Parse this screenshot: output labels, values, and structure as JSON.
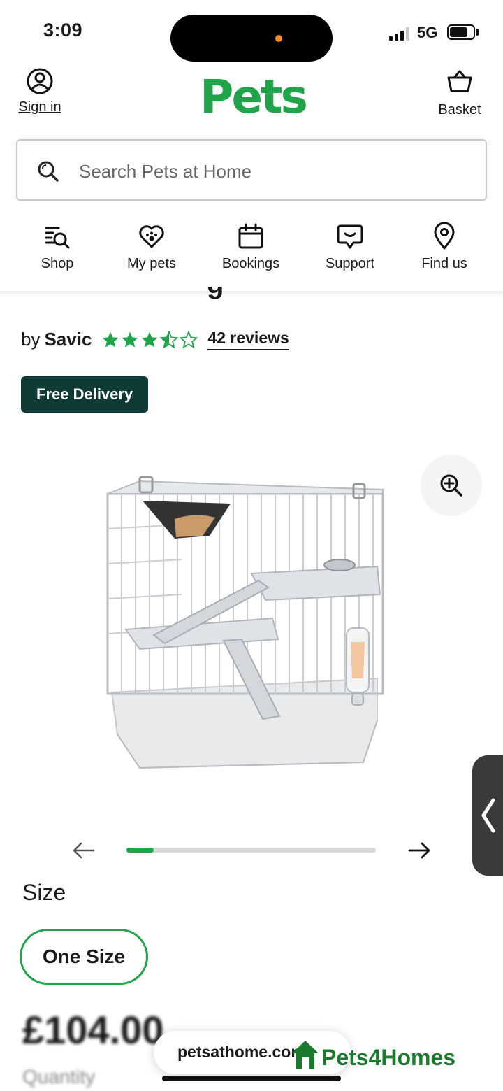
{
  "status_bar": {
    "time": "3:09",
    "network": "5G"
  },
  "header": {
    "sign_in_label": "Sign in",
    "logo_text": "Pets",
    "basket_label": "Basket",
    "brand_color": "#1fa44a"
  },
  "search": {
    "placeholder": "Search Pets at Home"
  },
  "quick_nav": {
    "items": [
      {
        "label": "Shop",
        "icon": "shop-search-icon"
      },
      {
        "label": "My pets",
        "icon": "heart-paw-icon"
      },
      {
        "label": "Bookings",
        "icon": "calendar-icon"
      },
      {
        "label": "Support",
        "icon": "chat-icon"
      },
      {
        "label": "Find us",
        "icon": "location-pin-icon"
      }
    ]
  },
  "product": {
    "title_fragment": "g",
    "by_prefix": "by",
    "brand": "Savic",
    "rating": 3.5,
    "rating_max": 5,
    "reviews_label": "42 reviews",
    "badge": "Free Delivery",
    "badge_color": "#0e3b35",
    "image_progress": 0.11,
    "size_label": "Size",
    "size_option": "One Size",
    "price": "£104.00",
    "quantity_label": "Quantity"
  },
  "browser": {
    "url": "petsathome.com"
  },
  "watermark": {
    "text": "Pets4Homes"
  }
}
